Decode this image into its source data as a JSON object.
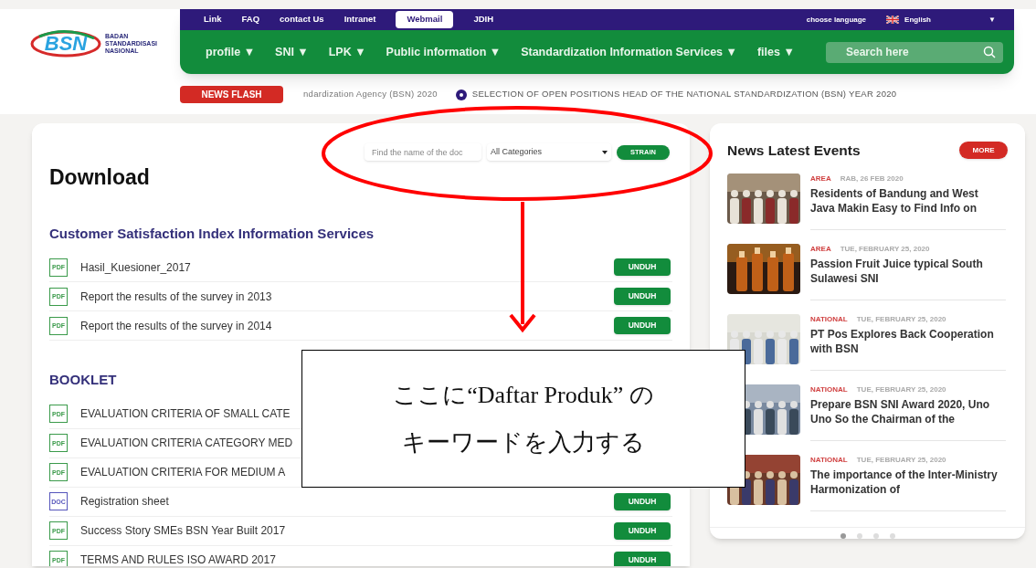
{
  "logo": {
    "mark": "BSN",
    "name": "BADAN STANDARDISASI NASIONAL"
  },
  "top_links": [
    {
      "label": "Link",
      "selected": false
    },
    {
      "label": "FAQ",
      "selected": false
    },
    {
      "label": "contact Us",
      "selected": false
    },
    {
      "label": "Intranet",
      "selected": false
    },
    {
      "label": "Webmail",
      "selected": true
    },
    {
      "label": "JDIH",
      "selected": false
    }
  ],
  "language": {
    "label": "choose language",
    "value": "English",
    "caret": "▼"
  },
  "menu": [
    {
      "label": "profile ▼"
    },
    {
      "label": "SNI ▼"
    },
    {
      "label": "LPK ▼"
    },
    {
      "label": "Public information ▼"
    },
    {
      "label": "Standardization Information Services ▼"
    },
    {
      "label": "files ▼"
    }
  ],
  "search": {
    "placeholder": "Search here"
  },
  "news_flash": {
    "label": "NEWS FLASH",
    "items": [
      "ndardization Agency (BSN) 2020",
      "SELECTION OF OPEN POSITIONS HEAD OF THE NATIONAL STANDARDIZATION (BSN) YEAR 2020"
    ]
  },
  "download": {
    "title": "Download",
    "filter": {
      "placeholder": "Find the name of the doc",
      "category": "All Categories",
      "button": "STRAIN"
    },
    "sections": [
      {
        "heading": "Customer Satisfaction Index Information Services",
        "files": [
          {
            "type": "PDF",
            "name": "Hasil_Kuesioner_2017",
            "button": "UNDUH"
          },
          {
            "type": "PDF",
            "name": "Report the results of the survey in 2013",
            "button": "UNDUH"
          },
          {
            "type": "PDF",
            "name": "Report the results of the survey in 2014",
            "button": "UNDUH"
          }
        ]
      },
      {
        "heading": "BOOKLET",
        "files": [
          {
            "type": "PDF",
            "name": "EVALUATION CRITERIA OF SMALL CATE"
          },
          {
            "type": "PDF",
            "name": "EVALUATION CRITERIA CATEGORY MED"
          },
          {
            "type": "PDF",
            "name": "EVALUATION CRITERIA FOR MEDIUM A"
          },
          {
            "type": "DOC",
            "name": "Registration sheet",
            "button": "UNDUH"
          },
          {
            "type": "PDF",
            "name": "Success Story SMEs BSN Year Built 2017",
            "button": "UNDUH"
          },
          {
            "type": "PDF",
            "name": "TERMS AND RULES ISO AWARD 2017",
            "button": "UNDUH"
          }
        ]
      }
    ]
  },
  "news": {
    "title": "News Latest Events",
    "more": "MORE",
    "items": [
      {
        "category": "AREA",
        "date": "RAB, 26 FEB 2020",
        "title": "Residents of Bandung and West Java Makin Easy to Find Info on",
        "kind": "picture"
      },
      {
        "category": "AREA",
        "date": "TUE, FEBRUARY 25, 2020",
        "title": "Passion Fruit Juice typical South Sulawesi SNI",
        "kind": "picture"
      },
      {
        "category": "NATIONAL",
        "date": "TUE, FEBRUARY 25, 2020",
        "title": "PT Pos Explores Back Cooperation with BSN",
        "kind": "picture"
      },
      {
        "category": "NATIONAL",
        "date": "TUE, FEBRUARY 25, 2020",
        "title": "Prepare BSN SNI Award 2020, Uno Uno So the Chairman of the",
        "kind": "picture"
      },
      {
        "category": "NATIONAL",
        "date": "TUE, FEBRUARY 25, 2020",
        "title": "The importance of the Inter-Ministry Harmonization of",
        "kind": "picture"
      }
    ],
    "dots": [
      {
        "selected": true
      },
      {
        "selected": false
      },
      {
        "selected": false
      },
      {
        "selected": false
      }
    ]
  },
  "callout": {
    "lines": [
      "ここに“Daftar Produk” の",
      "キーワードを入力する"
    ]
  }
}
